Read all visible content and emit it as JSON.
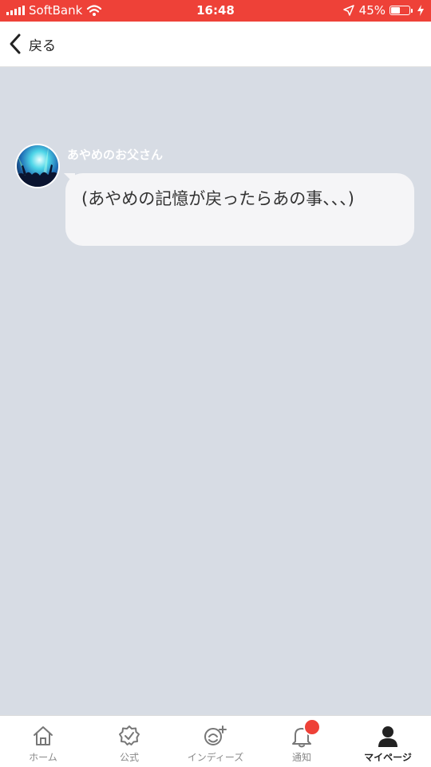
{
  "status_bar": {
    "carrier": "SoftBank",
    "time": "16:48",
    "battery_percent": "45%",
    "battery_level": 0.45,
    "icons": [
      "signal-icon",
      "wifi-icon",
      "location-icon",
      "battery-icon",
      "charging-icon"
    ]
  },
  "nav": {
    "back_label": "戻る",
    "back_icon": "chevron-left-icon"
  },
  "chat": {
    "sender_name": "あやめのお父さん",
    "message": "(あやめの記憶が戻ったらあの事、、、)",
    "background_color": "#d7dce4",
    "bubble_color": "#f5f5f7"
  },
  "tabs": [
    {
      "label": "ホーム",
      "icon": "home-icon",
      "active": false
    },
    {
      "label": "公式",
      "icon": "official-badge-icon",
      "active": false
    },
    {
      "label": "インディーズ",
      "icon": "indies-icon",
      "active": false
    },
    {
      "label": "通知",
      "icon": "bell-icon",
      "active": false,
      "badge": true
    },
    {
      "label": "マイページ",
      "icon": "user-icon",
      "active": true
    }
  ],
  "colors": {
    "accent": "#ee4138",
    "tab_active": "#222222",
    "tab_inactive": "#888888"
  }
}
